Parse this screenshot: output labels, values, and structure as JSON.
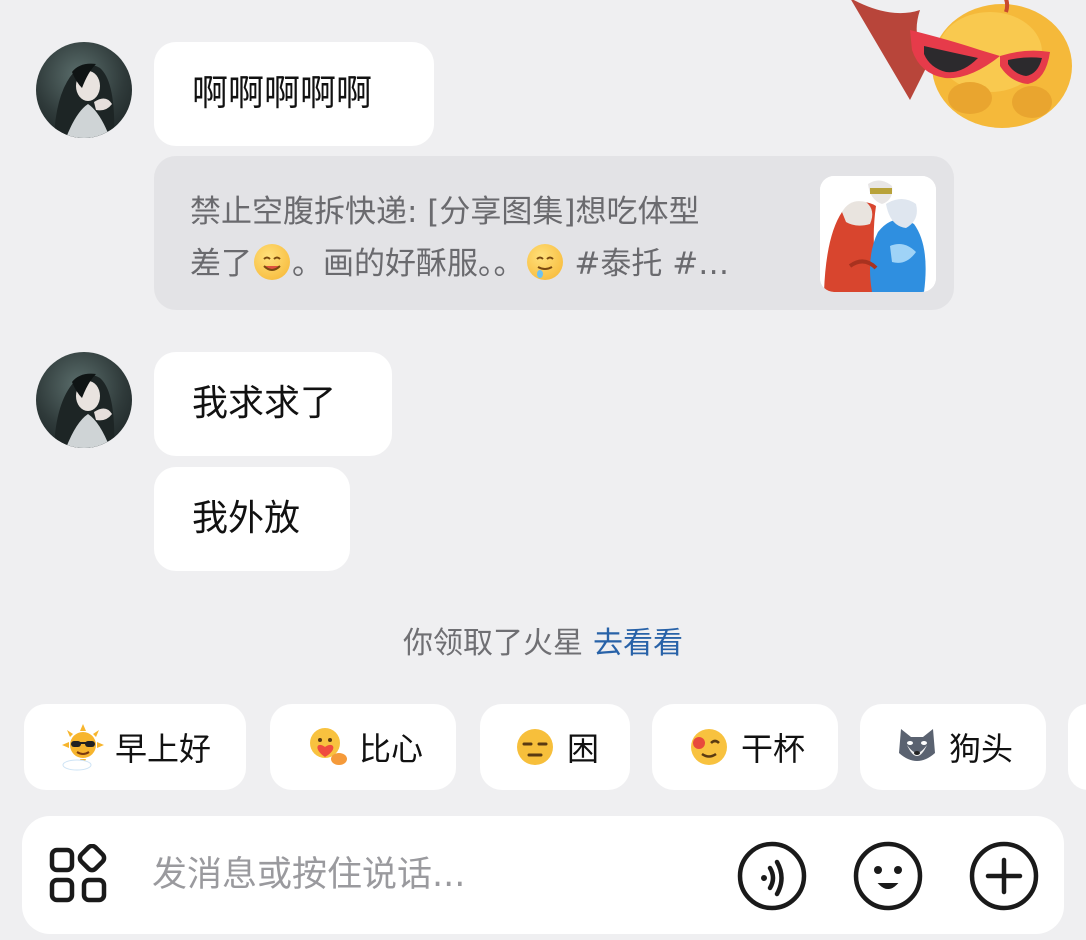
{
  "messages": [
    {
      "id": "m1",
      "text": "啊啊啊啊啊"
    },
    {
      "id": "m2",
      "text": "我求求了"
    },
    {
      "id": "m3",
      "text": "我外放"
    }
  ],
  "share_card": {
    "line1": "禁止空腹拆快递: [分享图集]想吃体型",
    "line2_a": "差了",
    "line2_b": "。画的好酥服。。",
    "line2_c": "#泰托 #…"
  },
  "system_note": {
    "text": "你领取了火星",
    "link": "去看看"
  },
  "quick_replies": [
    {
      "label": "早上好",
      "icon": "sun-sunglasses-icon"
    },
    {
      "label": "比心",
      "icon": "heart-hands-icon"
    },
    {
      "label": "困",
      "icon": "sleepy-face-icon"
    },
    {
      "label": "干杯",
      "icon": "cheers-face-icon"
    },
    {
      "label": "狗头",
      "icon": "dog-head-icon"
    }
  ],
  "input": {
    "placeholder": "发消息或按住说话..."
  },
  "colors": {
    "background": "#efeff1",
    "bubble": "#ffffff",
    "share_card": "#e3e3e6",
    "link": "#2862a8"
  }
}
